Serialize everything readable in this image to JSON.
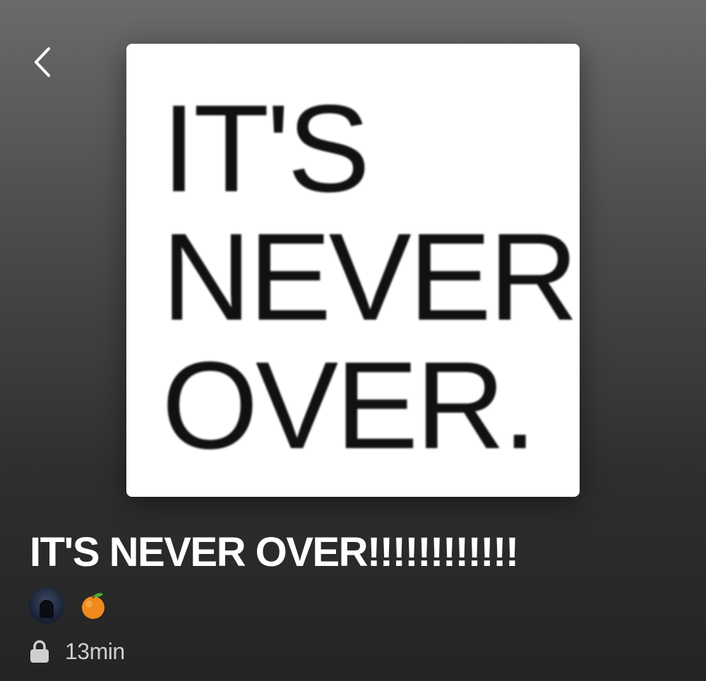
{
  "header": {
    "back_icon": "chevron-left-icon"
  },
  "cover": {
    "lines": "IT'S\nNEVER\nOVER."
  },
  "playlist": {
    "title": "IT'S NEVER OVER!!!!!!!!!!!!",
    "owners": [
      {
        "type": "photo-avatar"
      },
      {
        "type": "emoji-avatar",
        "icon": "orange-icon"
      }
    ],
    "visibility_icon": "lock-icon",
    "duration": "13min"
  },
  "colors": {
    "background_top": "#6a6a6a",
    "background_bottom": "#242424",
    "text_primary": "#ffffff",
    "text_secondary": "#cfcfcf"
  }
}
